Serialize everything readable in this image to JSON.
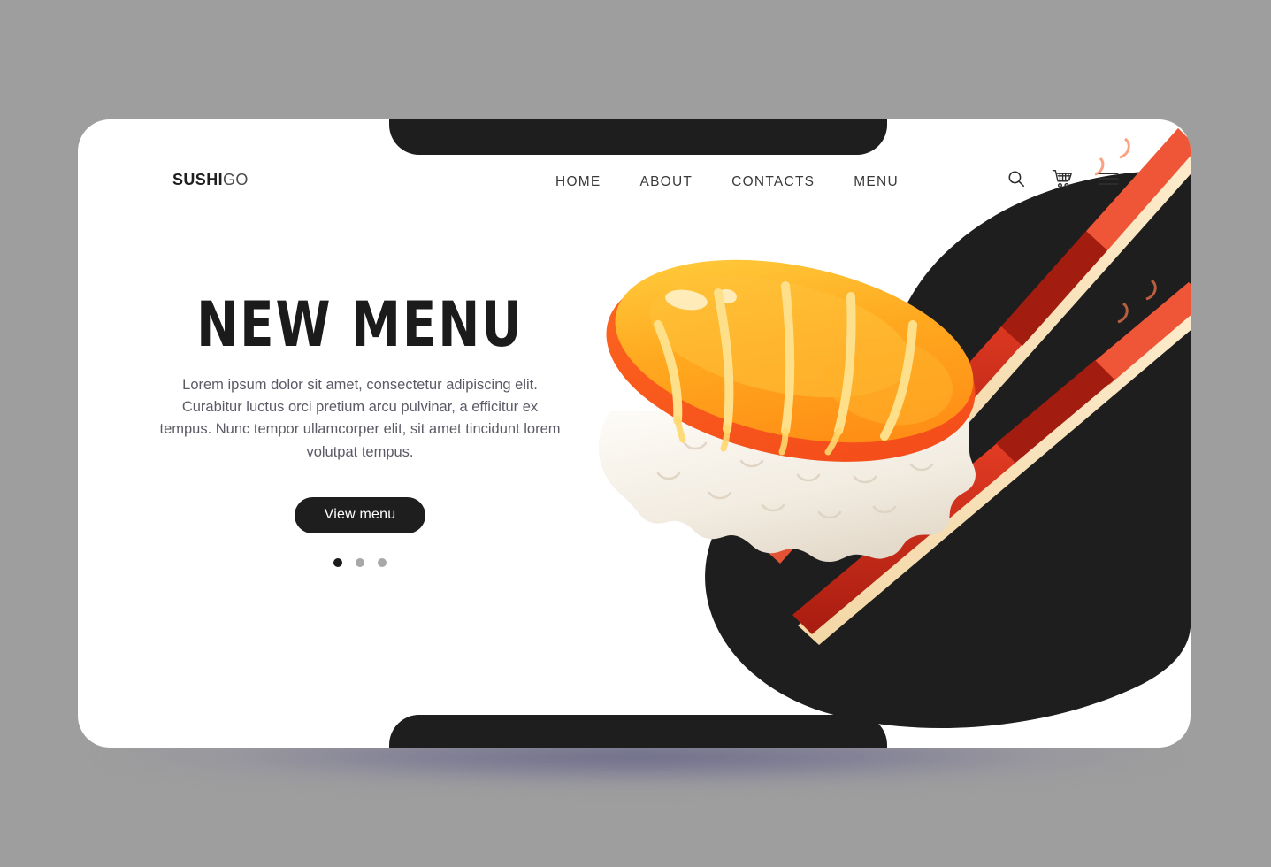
{
  "page": {
    "background_color": "#9e9e9e",
    "card_background": "#ffffff",
    "accent_dark": "#1e1e1e"
  },
  "header": {
    "logo": {
      "strong": "SUSHI",
      "light": "GO"
    },
    "nav": [
      {
        "label": "HOME"
      },
      {
        "label": "ABOUT"
      },
      {
        "label": "CONTACTS"
      },
      {
        "label": "MENU"
      }
    ],
    "actions": [
      {
        "name": "search-icon",
        "label": "Search"
      },
      {
        "name": "cart-icon",
        "label": "Cart"
      },
      {
        "name": "hamburger-menu-icon",
        "label": "Menu"
      }
    ]
  },
  "hero": {
    "title": "NEW MENU",
    "paragraph": "Lorem ipsum dolor sit amet, consectetur adipiscing elit. Curabitur luctus orci pretium arcu pulvinar, a efficitur ex tempus. Nunc tempor ullamcorper elit, sit amet tincidunt lorem volutpat tempus.",
    "cta_label": "View menu",
    "carousel": {
      "total": 3,
      "active_index": 0,
      "active_color": "#1b1b1b",
      "inactive_color": "#a8a8a8"
    }
  },
  "artwork": {
    "name": "sushi-nigiri-with-chopsticks-illustration",
    "blob_color": "#1e1e1e",
    "salmon_top": "#ffb31f",
    "salmon_mid": "#ff8c1a",
    "salmon_deep": "#f4541c",
    "rice_color": "#f4efe6",
    "chopstick_red": "#e8412a",
    "chopstick_dark": "#b01f13",
    "chopstick_wood": "#f7deb4"
  }
}
